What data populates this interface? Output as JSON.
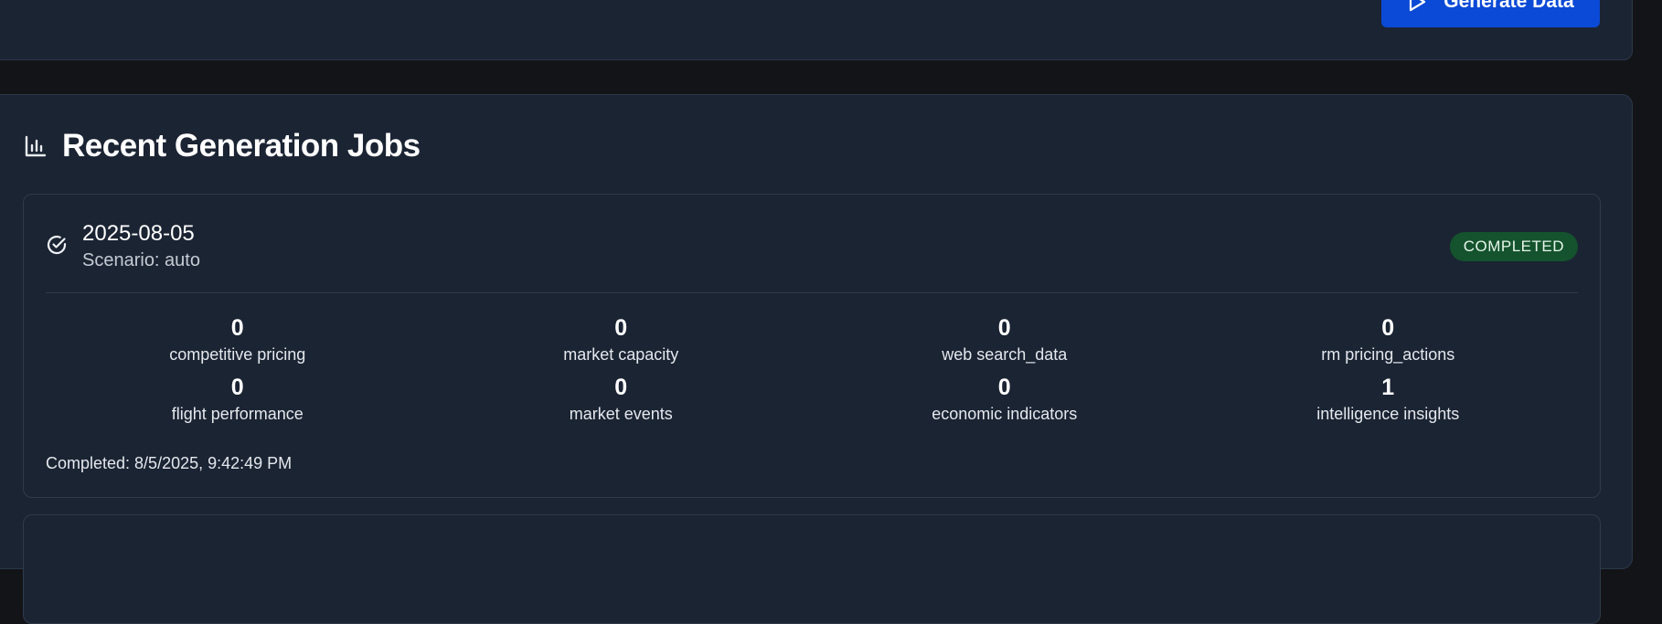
{
  "toolbar": {
    "generate_label": "Generate Data",
    "generate_icon": "play-icon"
  },
  "jobs_panel": {
    "title": "Recent Generation Jobs",
    "title_icon": "bar-chart-icon",
    "jobs": [
      {
        "date": "2025-08-05",
        "scenario": "Scenario: auto",
        "status": "COMPLETED",
        "status_color": "#14532d",
        "status_icon": "check-circle-icon",
        "stats": [
          {
            "value": "0",
            "label": "competitive pricing"
          },
          {
            "value": "0",
            "label": "market capacity"
          },
          {
            "value": "0",
            "label": "web search_data"
          },
          {
            "value": "0",
            "label": "rm pricing_actions"
          },
          {
            "value": "0",
            "label": "flight performance"
          },
          {
            "value": "0",
            "label": "market events"
          },
          {
            "value": "0",
            "label": "economic indicators"
          },
          {
            "value": "1",
            "label": "intelligence insights"
          }
        ],
        "completed": "Completed: 8/5/2025, 9:42:49 PM"
      }
    ]
  },
  "colors": {
    "page_bg": "#121418",
    "card_bg": "#1b2433",
    "border": "#2c3748",
    "primary": "#0b4ad6",
    "success": "#14532d"
  }
}
